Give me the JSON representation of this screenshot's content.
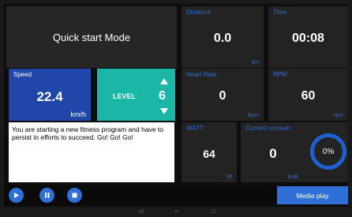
{
  "mode": {
    "title": "Quick start Mode"
  },
  "speed": {
    "label": "Speed",
    "value": "22.4",
    "unit": "km/h"
  },
  "level": {
    "label": "LEVEL",
    "value": "6"
  },
  "message": "You are starting a new fitness program and have to persist in efforts to succeed. Go! Go! Go!",
  "distance": {
    "label": "Distance",
    "value": "0.0",
    "unit": "km"
  },
  "time": {
    "label": "Time",
    "value": "00:08"
  },
  "heart_rate": {
    "label": "Heart Rate",
    "value": "0",
    "unit": "bpm"
  },
  "rpm": {
    "label": "RPM",
    "value": "60",
    "unit": "rpm"
  },
  "watt": {
    "label": "WATT",
    "value": "64",
    "unit": "W"
  },
  "current_consumption": {
    "label": "Current consum",
    "value": "0",
    "unit": "kcal",
    "percent": "0%"
  },
  "controls": {
    "media_label": "Media play"
  },
  "nav": {
    "back": "◁",
    "home": "○",
    "recent": "□"
  },
  "colors": {
    "accent": "#2f6fd6",
    "level_bg": "#1ab6a6",
    "speed_bg": "#1f46a8"
  }
}
